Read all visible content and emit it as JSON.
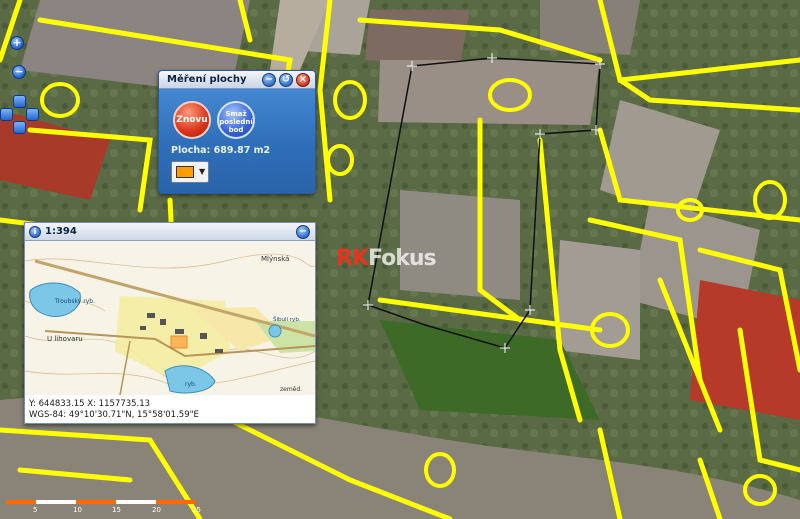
{
  "map": {
    "watermark_brand": "RK",
    "watermark_rest": "Fokus",
    "street_label": "Mlýnská"
  },
  "navigation": {
    "zoom_in_label": "+",
    "zoom_out_label": "−"
  },
  "measure_panel": {
    "title": "Měření plochy",
    "minimize_label": "−",
    "restore_label": "↺",
    "close_label": "×",
    "znovu_label": "Znovu",
    "smaz_label": "Smaž poslední bod",
    "area_text": "Plocha: 689.87 m2",
    "color": "#ff9c00"
  },
  "overview_panel": {
    "info_label": "i",
    "scale_label": "1:394",
    "collapse_label": "−",
    "map_labels": {
      "pond_1": "Troubský ryb.",
      "street": "U lihovaru",
      "pond_2": "ryb.",
      "mlynska": "Mlýnská",
      "sibula": "Šibuli ryb.",
      "zemedelsky": "zeměd."
    },
    "coord_line_1": "Y: 644833.15 X: 1157735.13",
    "coord_line_2": "WGS-84: 49°10'30.71\"N, 15°58'01.59\"E"
  },
  "scalebar": {
    "ticks": [
      "5",
      "10",
      "15",
      "20",
      "25"
    ]
  }
}
